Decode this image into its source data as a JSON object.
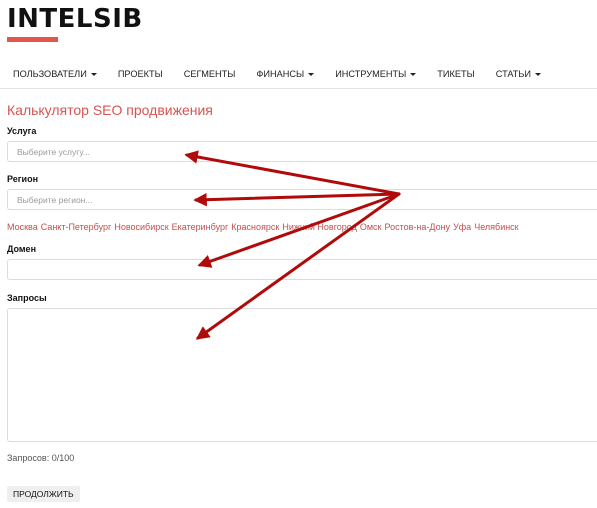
{
  "brand": {
    "logo_text": "INTELSIB",
    "accent_color": "#e2574c"
  },
  "nav": {
    "items": [
      {
        "label": "ПОЛЬЗОВАТЕЛИ",
        "dropdown": true
      },
      {
        "label": "ПРОЕКТЫ",
        "dropdown": false
      },
      {
        "label": "СЕГМЕНТЫ",
        "dropdown": false
      },
      {
        "label": "ФИНАНСЫ",
        "dropdown": true
      },
      {
        "label": "ИНСТРУМЕНТЫ",
        "dropdown": true
      },
      {
        "label": "ТИКЕТЫ",
        "dropdown": false
      },
      {
        "label": "СТАТЬИ",
        "dropdown": true
      }
    ]
  },
  "page": {
    "title": "Калькулятор SEO продвижения",
    "title_color": "#d9534f"
  },
  "form": {
    "service": {
      "label": "Услуга",
      "placeholder": "Выберите услугу..."
    },
    "region": {
      "label": "Регион",
      "placeholder": "Выберите регион..."
    },
    "cities": [
      "Москва",
      "Санкт-Петербург",
      "Новосибирск",
      "Екатеринбург",
      "Красноярск",
      "Нижний Новгород",
      "Омск",
      "Ростов-на-Дону",
      "Уфа",
      "Челябинск"
    ],
    "domain": {
      "label": "Домен",
      "value": ""
    },
    "queries": {
      "label": "Запросы",
      "value": ""
    },
    "counter": {
      "label": "Запросов:",
      "current": "0",
      "max": "100"
    },
    "submit_label": "ПРОДОЛЖИТЬ"
  },
  "annotation": {
    "arrow_color": "#b00a0a"
  }
}
